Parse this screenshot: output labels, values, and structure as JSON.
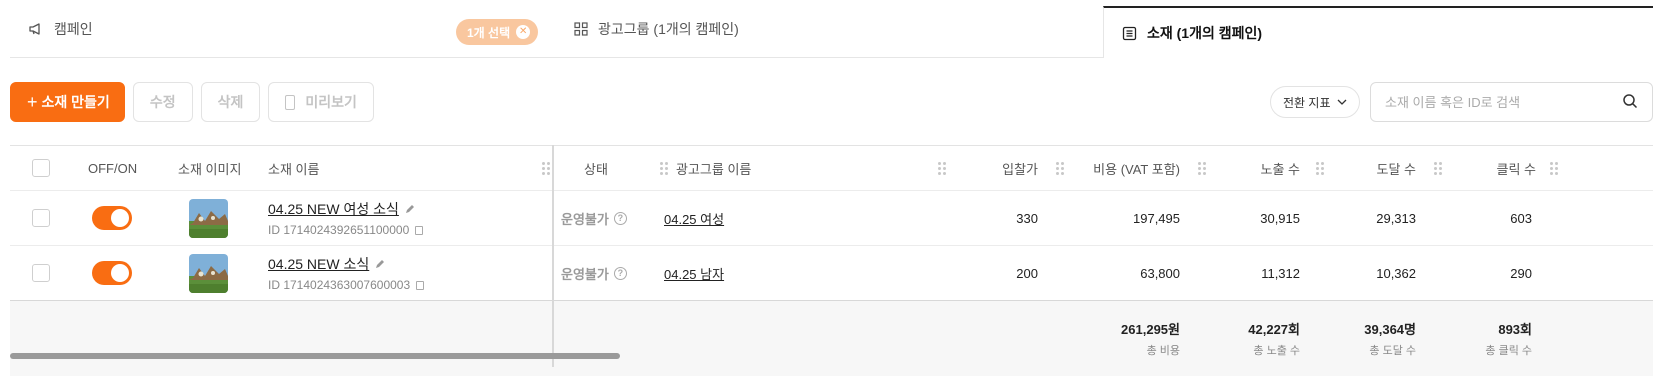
{
  "tabs": {
    "campaign": "캠페인",
    "selected_badge": "1개 선택",
    "adgroup": "광고그룹 (1개의 캠페인)",
    "creative": "소재 (1개의 캠페인)"
  },
  "toolbar": {
    "create": "소재 만들기",
    "edit": "수정",
    "delete": "삭제",
    "preview": "미리보기",
    "metric": "전환 지표",
    "search_placeholder": "소재 이름 혹은 ID로 검색"
  },
  "columns": {
    "onoff": "OFF/ON",
    "image": "소재 이미지",
    "name": "소재 이름",
    "status": "상태",
    "adgroup": "광고그룹 이름",
    "bid": "입찰가",
    "cost": "비용 (VAT 포함)",
    "impressions": "노출 수",
    "reach": "도달 수",
    "clicks": "클릭 수"
  },
  "rows": [
    {
      "name": "04.25 NEW 여성 소식",
      "id": "ID 1714024392651100000",
      "status": "운영불가",
      "adgroup": "04.25 여성",
      "bid": "330",
      "cost": "197,495",
      "impressions": "30,915",
      "reach": "29,313",
      "clicks": "603"
    },
    {
      "name": "04.25 NEW 소식",
      "id": "ID 1714024363007600003",
      "status": "운영불가",
      "adgroup": "04.25 남자",
      "bid": "200",
      "cost": "63,800",
      "impressions": "11,312",
      "reach": "10,362",
      "clicks": "290"
    }
  ],
  "totals": {
    "cost": "261,295원",
    "cost_label": "총 비용",
    "impressions": "42,227회",
    "impressions_label": "총 노출 수",
    "reach": "39,364명",
    "reach_label": "총 도달 수",
    "clicks": "893회",
    "clicks_label": "총 클릭 수"
  },
  "colors": {
    "accent": "#f96d12",
    "badge": "#f9c79f"
  }
}
